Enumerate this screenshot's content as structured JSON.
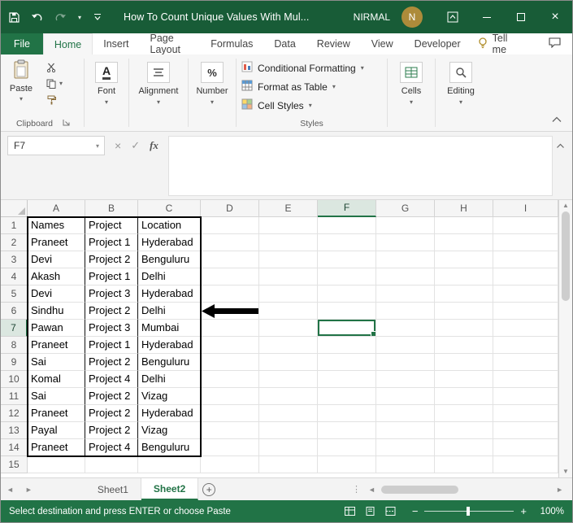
{
  "window": {
    "title": "How To Count Unique Values With Mul...",
    "user_name": "NIRMAL",
    "avatar_letter": "N"
  },
  "tabs": {
    "file": "File",
    "items": [
      "Home",
      "Insert",
      "Page Layout",
      "Formulas",
      "Data",
      "Review",
      "View",
      "Developer"
    ],
    "active": "Home",
    "tell_me": "Tell me"
  },
  "ribbon": {
    "paste": "Paste",
    "clipboard_label": "Clipboard",
    "font_label": "Font",
    "alignment_label": "Alignment",
    "number_label": "Number",
    "styles": {
      "conditional_formatting": "Conditional Formatting",
      "format_as_table": "Format as Table",
      "cell_styles": "Cell Styles",
      "label": "Styles"
    },
    "cells_label": "Cells",
    "editing_label": "Editing"
  },
  "formula_bar": {
    "name_box": "F7",
    "fx": "fx",
    "value": ""
  },
  "grid": {
    "columns": [
      "A",
      "B",
      "C",
      "D",
      "E",
      "F",
      "G",
      "H",
      "I"
    ],
    "row_count": 15,
    "selected_cell": "F7",
    "selected_column": "F",
    "selected_row": 7,
    "table": [
      [
        "Names",
        "Project",
        "Location"
      ],
      [
        "Praneet",
        "Project 1",
        "Hyderabad"
      ],
      [
        "Devi",
        "Project 2",
        "Benguluru"
      ],
      [
        "Akash",
        "Project 1",
        "Delhi"
      ],
      [
        "Devi",
        "Project 3",
        "Hyderabad"
      ],
      [
        "Sindhu",
        "Project 2",
        "Delhi"
      ],
      [
        "Pawan",
        "Project 3",
        "Mumbai"
      ],
      [
        "Praneet",
        "Project 1",
        "Hyderabad"
      ],
      [
        "Sai",
        "Project 2",
        "Benguluru"
      ],
      [
        "Komal",
        "Project 4",
        "Delhi"
      ],
      [
        "Sai",
        "Project 2",
        "Vizag"
      ],
      [
        "Praneet",
        "Project 2",
        "Hyderabad"
      ],
      [
        "Payal",
        "Project 2",
        "Vizag"
      ],
      [
        "Praneet",
        "Project 4",
        "Benguluru"
      ]
    ]
  },
  "sheets": {
    "items": [
      "Sheet1",
      "Sheet2"
    ],
    "active": "Sheet2"
  },
  "status_bar": {
    "message": "Select destination and press ENTER or choose Paste",
    "zoom": "100%"
  },
  "icons": {
    "dropdown": "▾",
    "cancel": "×",
    "enter": "✓",
    "close": "×",
    "up": "▲",
    "down": "▼",
    "left": "◄",
    "right": "►",
    "add": "+",
    "splitter": "⋮",
    "zoom_out": "−",
    "zoom_in": "+"
  },
  "colors": {
    "titlebar": "#185C37",
    "accent": "#217346",
    "status_bar": "#217346",
    "avatar": "#AD8B3A"
  }
}
